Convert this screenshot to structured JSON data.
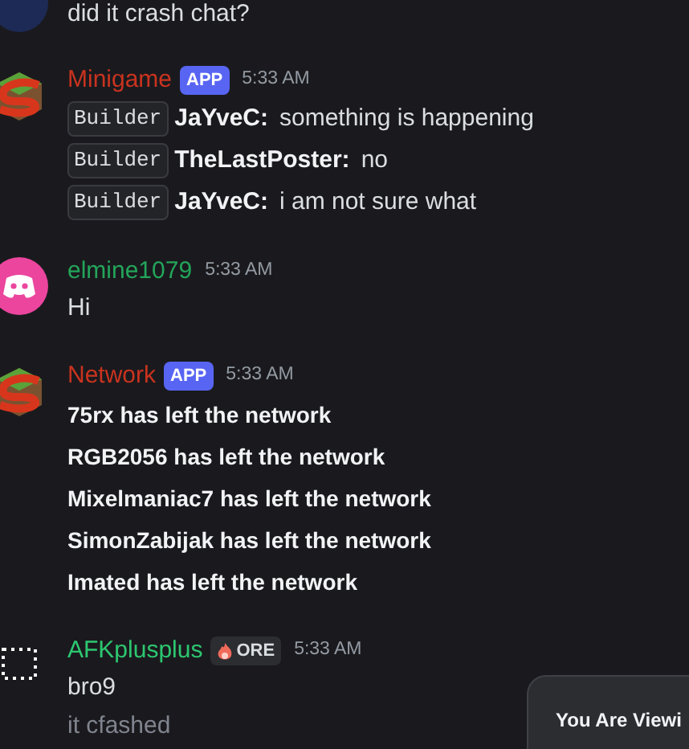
{
  "messages": [
    {
      "kind": "photo",
      "lines": [
        {
          "kind": "plain",
          "text": "did it crash chat?"
        }
      ]
    },
    {
      "kind": "app",
      "author": {
        "name": "Minigame",
        "color": "#c9331f",
        "tag": {
          "kind": "app",
          "text": "APP"
        },
        "time": "5:33 AM"
      },
      "lines": [
        {
          "kind": "tagged",
          "role": "Builder",
          "user": "JaYveC:",
          "text": "something is happening"
        },
        {
          "kind": "tagged",
          "role": "Builder",
          "user": "TheLastPoster:",
          "text": "no"
        },
        {
          "kind": "tagged",
          "role": "Builder",
          "user": "JaYveC:",
          "text": "i am not sure what"
        }
      ]
    },
    {
      "kind": "discord",
      "author": {
        "name": "elmine1079",
        "color": "#23a55a",
        "time": "5:33 AM"
      },
      "lines": [
        {
          "kind": "plain",
          "text": "Hi"
        }
      ]
    },
    {
      "kind": "app",
      "author": {
        "name": "Network",
        "color": "#c9331f",
        "tag": {
          "kind": "app",
          "text": "APP"
        },
        "time": "5:33 AM"
      },
      "lines": [
        {
          "kind": "bold",
          "text": "75rx has left the network"
        },
        {
          "kind": "bold",
          "text": "RGB2056 has left the network"
        },
        {
          "kind": "bold",
          "text": "Mixelmaniac7 has left the network"
        },
        {
          "kind": "bold",
          "text": "SimonZabijak has left the network"
        },
        {
          "kind": "bold",
          "text": "Imated has left the network"
        }
      ]
    },
    {
      "kind": "loading",
      "author": {
        "name": "AFKplusplus",
        "color": "#2dc770",
        "tag": {
          "kind": "guild",
          "text": "ORE"
        },
        "time": "5:33 AM"
      },
      "lines": [
        {
          "kind": "plain",
          "text": "bro9",
          "pending": false
        },
        {
          "kind": "plain",
          "text": "it cfashed",
          "pending": true
        }
      ]
    }
  ],
  "toast": {
    "text": "You Are Viewi"
  }
}
